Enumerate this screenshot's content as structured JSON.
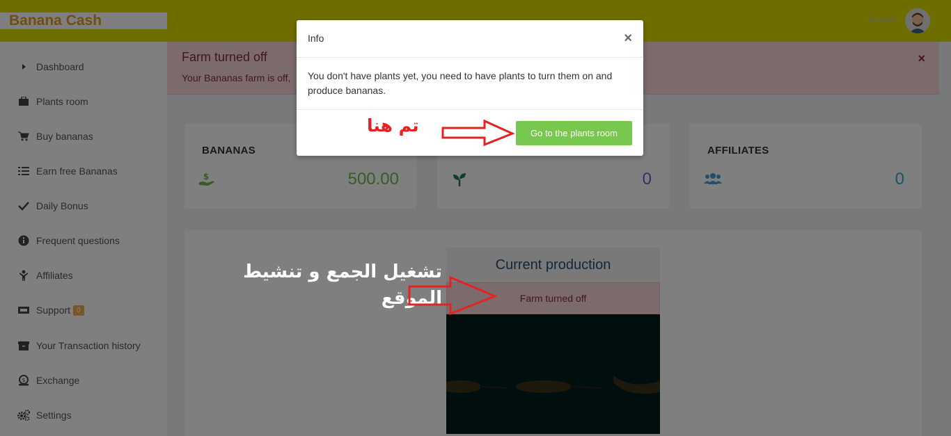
{
  "header": {
    "brand": "Banana Cash",
    "username": "Liver20"
  },
  "sidebar": {
    "items": [
      {
        "label": "Dashboard",
        "icon": "caret-right-icon"
      },
      {
        "label": "Plants room",
        "icon": "briefcase-icon"
      },
      {
        "label": "Buy bananas",
        "icon": "cart-icon"
      },
      {
        "label": "Earn free Bananas",
        "icon": "list-icon"
      },
      {
        "label": "Daily Bonus",
        "icon": "check-icon"
      },
      {
        "label": "Frequent questions",
        "icon": "info-icon"
      },
      {
        "label": "Affiliates",
        "icon": "child-icon"
      },
      {
        "label": "Support",
        "icon": "ticket-icon",
        "badge": "0"
      },
      {
        "label": "Your Transaction history",
        "icon": "archive-icon"
      },
      {
        "label": "Exchange",
        "icon": "money-icon"
      },
      {
        "label": "Settings",
        "icon": "gears-icon"
      }
    ]
  },
  "alert": {
    "title": "Farm turned off",
    "text": "Your Bananas farm is off,"
  },
  "cards": [
    {
      "title": "BANANAS",
      "value": "500.00",
      "icon": "hand-dollar-icon",
      "color": "#6fb84c"
    },
    {
      "title": "",
      "value": "0",
      "icon": "seedling-icon",
      "color": "#5c6bc0"
    },
    {
      "title": "AFFILIATES",
      "value": "0",
      "icon": "users-icon",
      "color": "#3ea5d4"
    }
  ],
  "production": {
    "title": "Current production",
    "status": "Farm turned off"
  },
  "modal": {
    "title": "Info",
    "body": "You don't have plants yet, you need to have plants to turn them on and produce bananas.",
    "button": "Go to the plants room"
  },
  "annotations": {
    "click_here": "تم هنا",
    "activate": "تشغيل الجمع و تنشيط الموقع"
  },
  "colors": {
    "topbar": "#dddd00",
    "brand": "#e39a1e",
    "button": "#78c850",
    "annotation_red": "#e52222"
  }
}
